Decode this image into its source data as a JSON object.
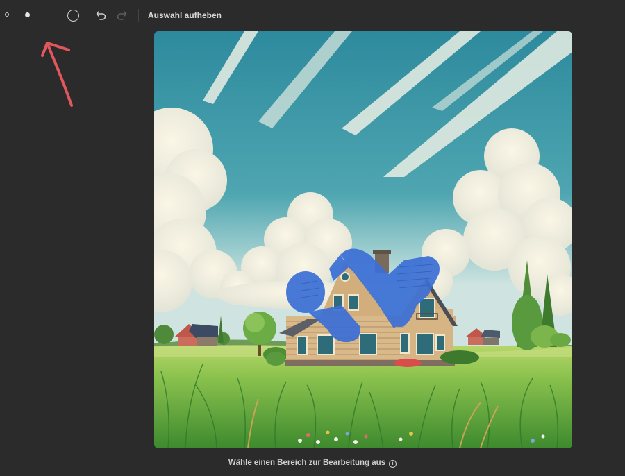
{
  "toolbar": {
    "brush_size_level": 0.24,
    "deselect_label": "Auswahl aufheben",
    "icons": {
      "brush_small": "circle-small-icon",
      "brush_large": "circle-large-icon",
      "undo": "undo-icon",
      "redo": "redo-icon"
    }
  },
  "annotation": {
    "color": "#e2575b",
    "icon": "arrow-up-icon"
  },
  "canvas": {
    "image": "painting-house-in-meadow",
    "selection_color": "#3b6fd6"
  },
  "footer": {
    "hint": "Wähle einen Bereich zur Bearbeitung aus",
    "info_glyph": "i"
  }
}
